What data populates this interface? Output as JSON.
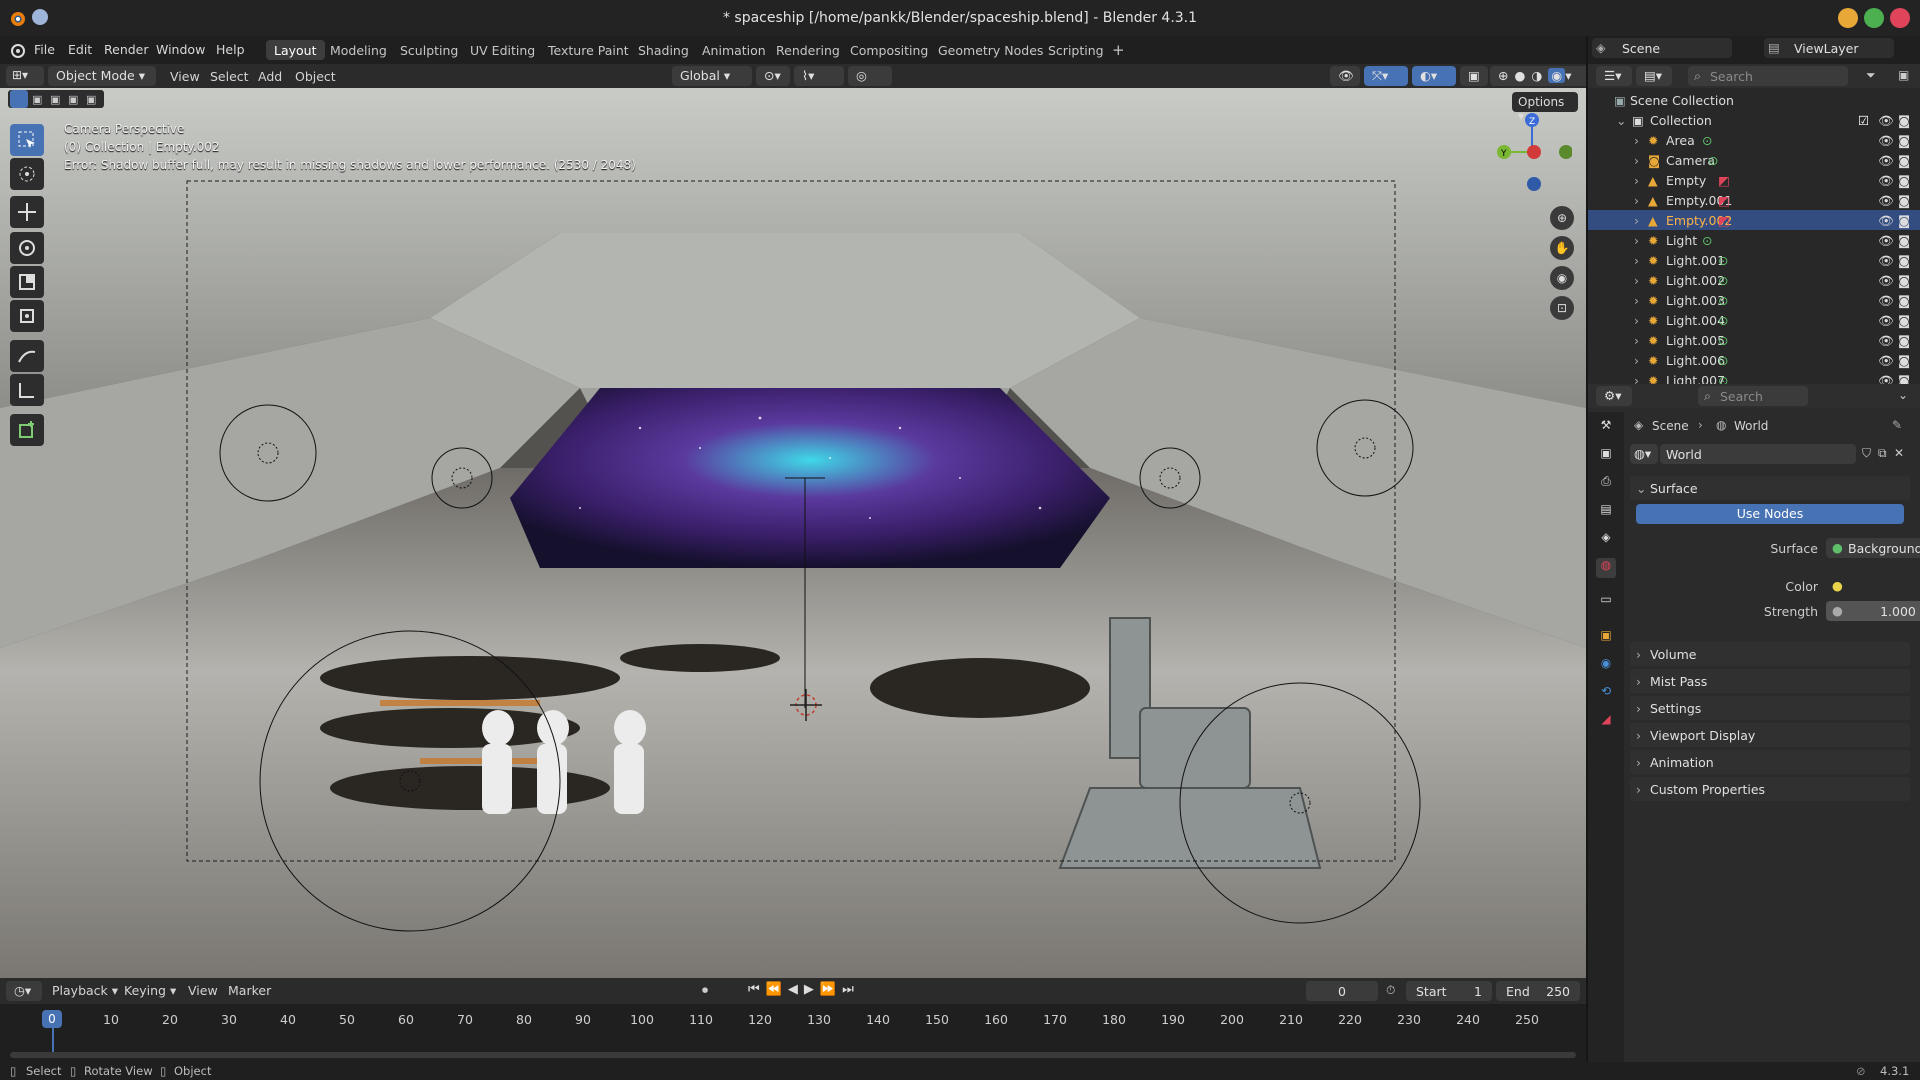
{
  "window": {
    "title": "* spaceship [/home/pankk/Blender/spaceship.blend] - Blender 4.3.1"
  },
  "menu": {
    "items": [
      "File",
      "Edit",
      "Render",
      "Window",
      "Help"
    ],
    "workspaces": [
      "Layout",
      "Modeling",
      "Sculpting",
      "UV Editing",
      "Texture Paint",
      "Shading",
      "Animation",
      "Rendering",
      "Compositing",
      "Geometry Nodes",
      "Scripting"
    ],
    "active_workspace": "Layout",
    "scene_name": "Scene",
    "view_layer": "ViewLayer"
  },
  "viewport_header": {
    "mode": "Object Mode",
    "menus": [
      "View",
      "Select",
      "Add",
      "Object"
    ],
    "transform_orientation": "Global",
    "options": "Options"
  },
  "viewport_overlay": {
    "line1": "Camera Perspective",
    "line2": "(0) Collection | Empty.002",
    "line3": "Error: Shadow buffer full, may result in missing shadows and lower performance. (2530 / 2048)"
  },
  "outliner": {
    "search_placeholder": "Search",
    "scene_collection": "Scene Collection",
    "collection": "Collection",
    "items": [
      {
        "name": "Area",
        "selected": false
      },
      {
        "name": "Camera",
        "selected": false
      },
      {
        "name": "Empty",
        "selected": false
      },
      {
        "name": "Empty.001",
        "selected": false
      },
      {
        "name": "Empty.002",
        "selected": true
      },
      {
        "name": "Light",
        "selected": false
      },
      {
        "name": "Light.001",
        "selected": false
      },
      {
        "name": "Light.002",
        "selected": false
      },
      {
        "name": "Light.003",
        "selected": false
      },
      {
        "name": "Light.004",
        "selected": false
      },
      {
        "name": "Light.005",
        "selected": false
      },
      {
        "name": "Light.006",
        "selected": false
      },
      {
        "name": "Light.007",
        "selected": false
      }
    ]
  },
  "properties": {
    "search_placeholder": "Search",
    "breadcrumb": [
      "Scene",
      "World"
    ],
    "world_name": "World",
    "surface_panel": "Surface",
    "use_nodes": "Use Nodes",
    "surface_label": "Surface",
    "surface_value": "Background",
    "color_label": "Color",
    "strength_label": "Strength",
    "strength_value": "1.000",
    "panels": [
      "Volume",
      "Mist Pass",
      "Settings",
      "Viewport Display",
      "Animation",
      "Custom Properties"
    ]
  },
  "timeline": {
    "menus": [
      "Playback",
      "Keying",
      "View",
      "Marker"
    ],
    "current_frame": "0",
    "start_label": "Start",
    "start_value": "1",
    "end_label": "End",
    "end_value": "250",
    "ticks": [
      "0",
      "10",
      "20",
      "30",
      "40",
      "50",
      "60",
      "70",
      "80",
      "90",
      "100",
      "110",
      "120",
      "130",
      "140",
      "150",
      "160",
      "170",
      "180",
      "190",
      "200",
      "210",
      "220",
      "230",
      "240",
      "250"
    ]
  },
  "statusbar": {
    "select": "Select",
    "rotate": "Rotate View",
    "object": "Object",
    "version": "4.3.1"
  },
  "colors": {
    "accent": "#4772b3",
    "selection": "#334d80",
    "close": "#e0445a",
    "minimize": "#e8a838",
    "maximize": "#4caf50"
  }
}
